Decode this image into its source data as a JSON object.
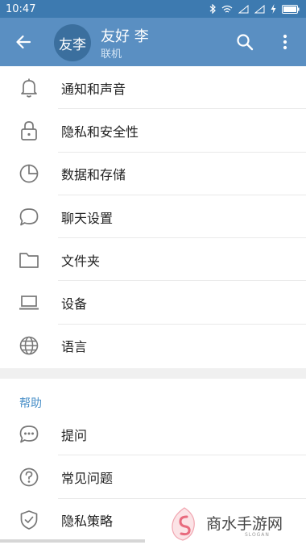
{
  "status_bar": {
    "time": "10:47",
    "icons": [
      "bluetooth-icon",
      "wifi-icon",
      "signal-icon",
      "signal-icon",
      "charging-icon",
      "battery-icon"
    ]
  },
  "header": {
    "avatar_text": "友李",
    "name": "友好 李",
    "status": "联机",
    "colors": {
      "bar": "#5a8fc2",
      "status_bar": "#3d7ab0",
      "avatar": "#3b6f9e"
    }
  },
  "settings": {
    "items": [
      {
        "label": "通知和声音",
        "icon": "bell-icon"
      },
      {
        "label": "隐私和安全性",
        "icon": "lock-icon"
      },
      {
        "label": "数据和存储",
        "icon": "pie-chart-icon"
      },
      {
        "label": "聊天设置",
        "icon": "chat-bubble-icon"
      },
      {
        "label": "文件夹",
        "icon": "folder-icon"
      },
      {
        "label": "设备",
        "icon": "laptop-icon"
      },
      {
        "label": "语言",
        "icon": "globe-icon"
      }
    ]
  },
  "help": {
    "title": "帮助",
    "accent": "#4a90c8",
    "items": [
      {
        "label": "提问",
        "icon": "chat-dots-icon"
      },
      {
        "label": "常见问题",
        "icon": "question-icon"
      },
      {
        "label": "隐私策略",
        "icon": "shield-check-icon"
      }
    ]
  },
  "watermark": {
    "text": "商水手游网",
    "sub": "SLOGAN"
  }
}
